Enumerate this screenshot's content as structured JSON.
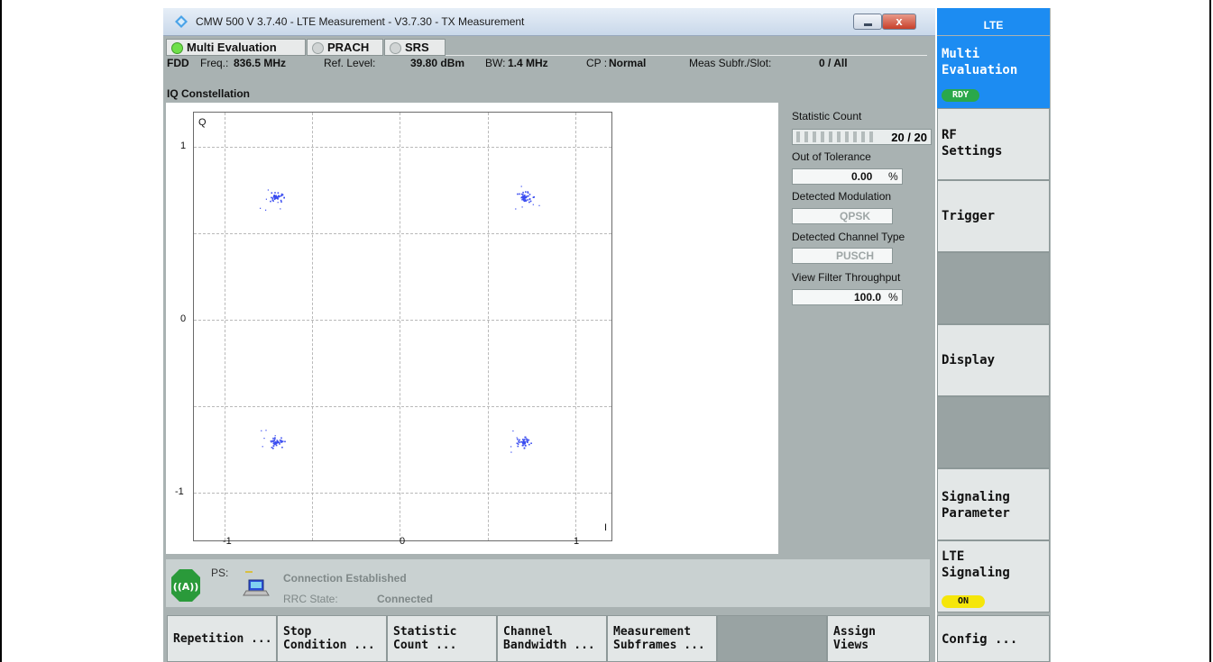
{
  "window": {
    "title": "CMW 500 V 3.7.40 - LTE Measurement  - V3.7.30 - TX Measurement",
    "close_label": "x"
  },
  "tabs": [
    {
      "label": "Multi Evaluation",
      "led": "#6fe04a"
    },
    {
      "label": "PRACH",
      "led": "#d0d4d4"
    },
    {
      "label": "SRS",
      "led": "#d0d4d4"
    }
  ],
  "info": {
    "mode": "FDD",
    "freq_label": "Freq.:",
    "freq_value": "836.5 MHz",
    "ref_label": "Ref. Level:",
    "ref_value": "39.80 dBm",
    "bw_label": "BW:",
    "bw_value": "1.4 MHz",
    "cp_label": "CP :",
    "cp_value": "Normal",
    "meas_label": "Meas Subfr./Slot:",
    "meas_value": "0  / All"
  },
  "view_title": "IQ Constellation",
  "chart_data": {
    "type": "scatter",
    "title": "IQ Constellation",
    "xlabel": "I",
    "ylabel": "Q",
    "xlim": [
      -1.1,
      1.3
    ],
    "ylim": [
      -1.25,
      1.25
    ],
    "x_ticks": [
      "-1",
      "0",
      "1"
    ],
    "y_ticks": [
      "1",
      "0",
      "-1"
    ],
    "grid": true,
    "series": [
      {
        "name": "",
        "color": "#3a4df0",
        "clusters": [
          {
            "x": -0.71,
            "y": 0.71
          },
          {
            "x": 0.71,
            "y": 0.71
          },
          {
            "x": -0.71,
            "y": -0.71
          },
          {
            "x": 0.71,
            "y": -0.71
          }
        ]
      }
    ]
  },
  "stats": {
    "statistic_count_label": "Statistic Count",
    "statistic_count_value": "20 / 20",
    "statistic_fraction": 1.0,
    "out_of_tolerance_label": "Out of Tolerance",
    "out_of_tolerance_value": "0.00",
    "percent_unit": "%",
    "detected_modulation_label": "Detected Modulation",
    "detected_modulation_value": "QPSK",
    "detected_channel_label": "Detected Channel Type",
    "detected_channel_value": "PUSCH",
    "view_filter_label": "View Filter Throughput",
    "view_filter_value": "100.0"
  },
  "status": {
    "ps_label": "PS:",
    "connection": "Connection Established",
    "rrc_label": "RRC State:",
    "rrc_value": "Connected"
  },
  "softkeys": [
    "Repetition ...",
    "Stop\nCondition ...",
    "Statistic\nCount ...",
    "Channel\nBandwidth ...",
    "Measurement\nSubframes ...",
    "",
    "Assign\nViews"
  ],
  "sidebar": {
    "header": "LTE",
    "multi_eval": "Multi\nEvaluation",
    "multi_badge": "RDY",
    "rf_settings": "RF\nSettings",
    "trigger": "Trigger",
    "display": "Display",
    "signaling_param": "Signaling\nParameter",
    "lte_signaling": "LTE\nSignaling",
    "lte_badge": "ON",
    "config": "Config ..."
  }
}
